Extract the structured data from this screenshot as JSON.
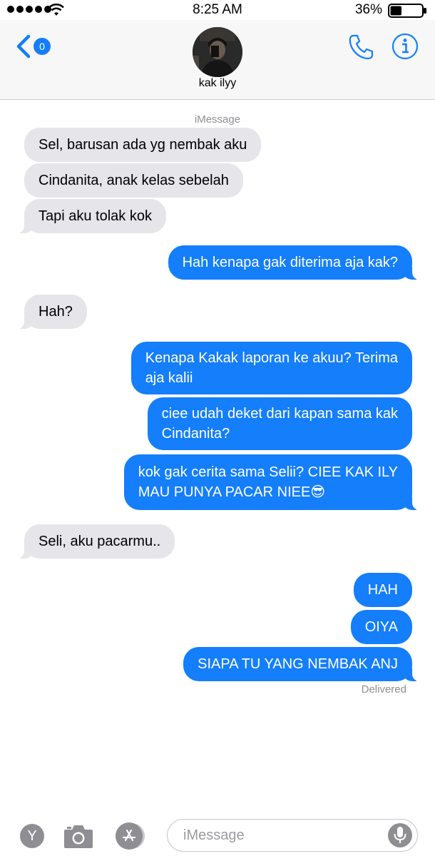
{
  "status_bar": {
    "time": "8:25 AM",
    "battery_percent": "36%",
    "battery_level": 0.36,
    "signal_dots": 5
  },
  "header": {
    "back_badge": "0",
    "contact_name": "kak ilyy",
    "icons": {
      "back": "chevron-left-icon",
      "call": "phone-icon",
      "info": "info-icon"
    },
    "accent_color": "#147efb"
  },
  "conversation": {
    "service_label": "iMessage",
    "messages": [
      {
        "dir": "in",
        "text": "Sel, barusan ada yg nembak aku"
      },
      {
        "dir": "in",
        "text": "Cindanita, anak kelas sebelah"
      },
      {
        "dir": "in",
        "text": "Tapi aku tolak kok"
      },
      {
        "dir": "out",
        "text": "Hah kenapa gak diterima aja kak?"
      },
      {
        "dir": "in",
        "text": "Hah?"
      },
      {
        "dir": "out",
        "text": "Kenapa Kakak laporan ke akuu? Terima\naja kalii"
      },
      {
        "dir": "out",
        "text": "ciee udah deket dari kapan sama kak\nCindanita?"
      },
      {
        "dir": "out",
        "text": "kok gak cerita sama Selii? CIEE KAK ILY\nMAU PUNYA PACAR NIEE😎"
      },
      {
        "dir": "in",
        "text": "Seli, aku pacarmu.."
      },
      {
        "dir": "out",
        "text": "HAH"
      },
      {
        "dir": "out",
        "text": "OIYA"
      },
      {
        "dir": "out",
        "text": "SIAPA TU YANG NEMBAK ANJ"
      }
    ],
    "delivered_label": "Delivered",
    "incoming_color": "#e5e5ea",
    "outgoing_color": "#147efb"
  },
  "input_bar": {
    "placeholder": "iMessage",
    "icons": {
      "apps": "y-app-icon",
      "camera": "camera-icon",
      "store": "app-store-icon",
      "mic": "microphone-icon"
    },
    "apps_label": "Y"
  }
}
